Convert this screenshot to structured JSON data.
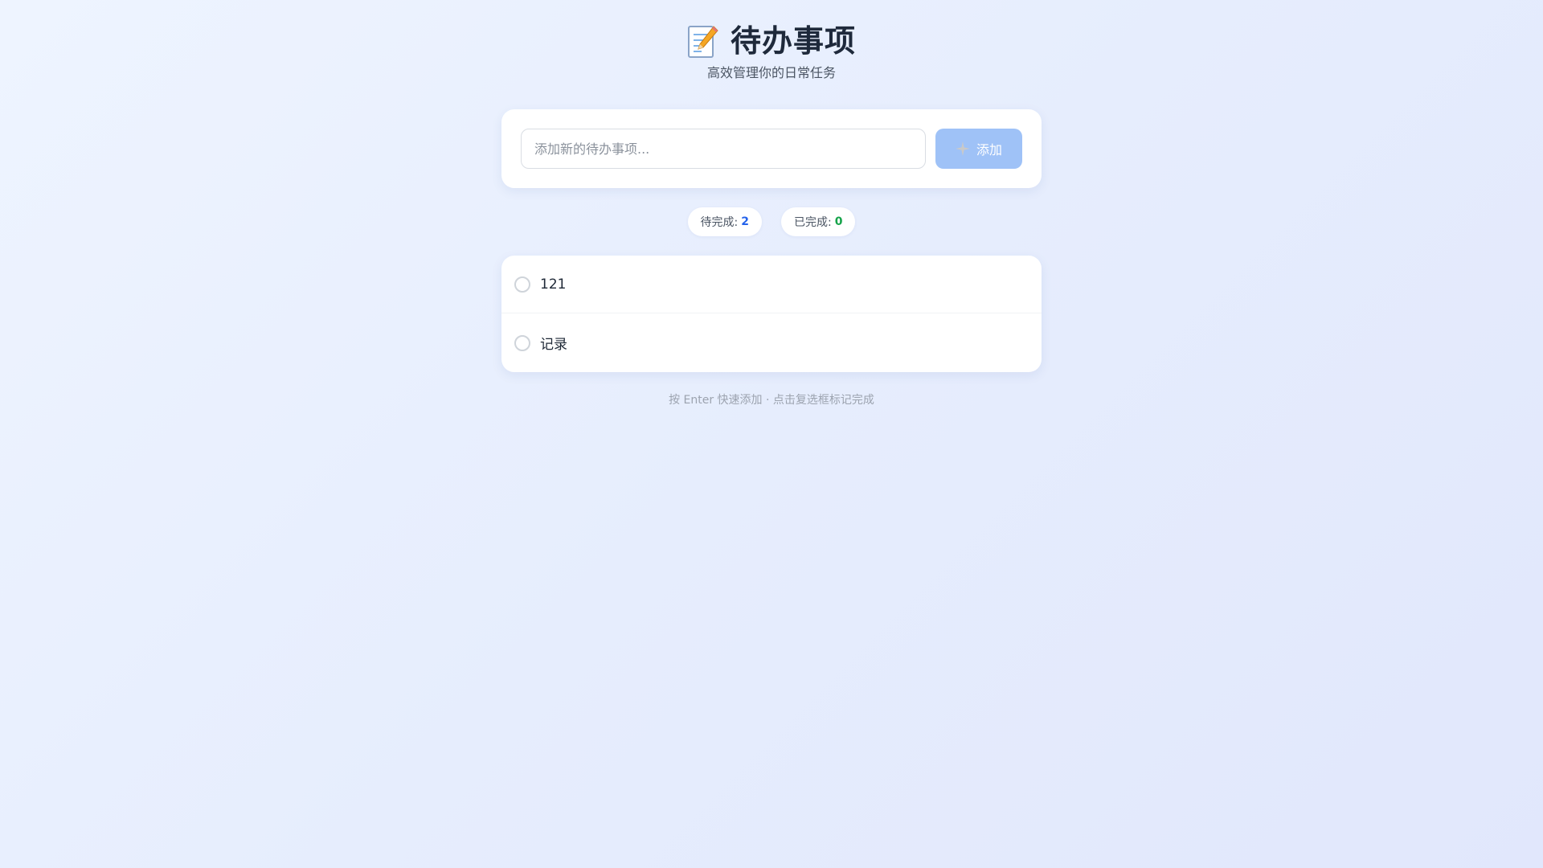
{
  "header": {
    "icon": "memo-icon",
    "title": "待办事项",
    "subtitle": "高效管理你的日常任务"
  },
  "input": {
    "placeholder": "添加新的待办事项...",
    "value": ""
  },
  "add_button": {
    "icon": "sparkle-icon",
    "label": "添加"
  },
  "stats": {
    "pending_label": "待完成:",
    "pending_count": "2",
    "completed_label": "已完成:",
    "completed_count": "0"
  },
  "todos": [
    {
      "text": "121",
      "completed": false
    },
    {
      "text": "记录",
      "completed": false
    }
  ],
  "footer_hint": "按 Enter 快速添加 · 点击复选框标记完成",
  "colors": {
    "accent": "#9fc2f7",
    "pending": "#2563eb",
    "completed": "#16a34a",
    "background": "#e6edfd"
  }
}
